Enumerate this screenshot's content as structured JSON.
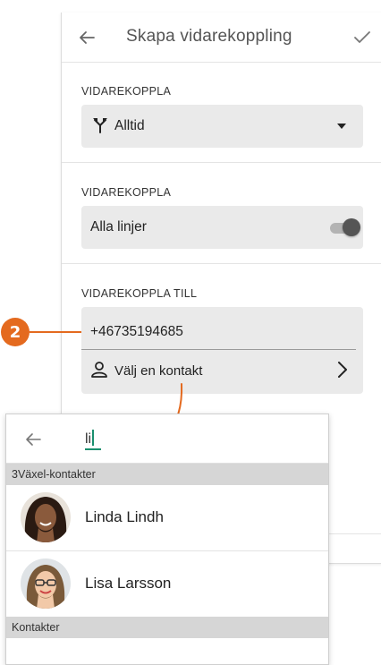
{
  "appbar": {
    "title": "Skapa vidarekoppling",
    "back_icon": "arrow-left-icon",
    "confirm_icon": "check-icon"
  },
  "section1": {
    "label": "VIDAREKOPPLA",
    "value": "Alltid",
    "icon": "call-split-icon"
  },
  "section2": {
    "label": "VIDAREKOPPLA",
    "value": "Alla linjer",
    "toggle_on": true
  },
  "section3": {
    "label": "VIDAREKOPPLA TILL",
    "number": "+46735194685",
    "contact_label": "Välj en kontakt"
  },
  "annotation": {
    "badge": "2",
    "color": "#e46a1f"
  },
  "overlay": {
    "search_value": "li",
    "groups": [
      {
        "header": "3Växel-kontakter",
        "contacts": [
          {
            "name": "Linda Lindh"
          },
          {
            "name": "Lisa Larsson"
          }
        ]
      },
      {
        "header": "Kontakter",
        "contacts": []
      }
    ]
  },
  "colors": {
    "accent": "#1a8f6e",
    "field_bg": "#eaeaea",
    "group_header_bg": "#d6d6d6"
  }
}
